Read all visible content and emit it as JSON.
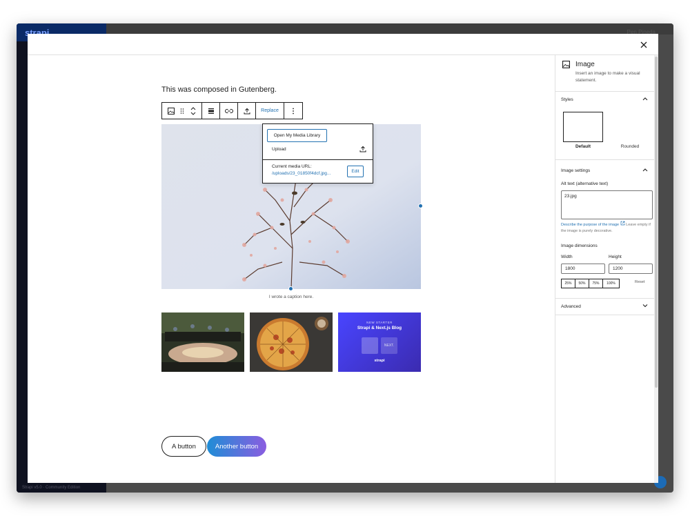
{
  "background": {
    "brand": "strapi",
    "user_menu": "Pen Pineda",
    "footer": "Strapi v5.0 · Community Edition"
  },
  "editor": {
    "paragraph": "This was composed in Gutenberg.",
    "toolbar": {
      "replace_label": "Replace",
      "icons": [
        "image-icon",
        "drag-icon",
        "move-updown-icon",
        "align-icon",
        "link-icon",
        "upload-icon",
        "more-vertical-icon"
      ]
    },
    "replace_popover": {
      "open_library": "Open My Media Library",
      "upload": "Upload",
      "current_url_label": "Current media URL:",
      "current_url": "/uploads/23_01850f4dcf.jpg...",
      "edit": "Edit"
    },
    "caption": "I wrote a caption here.",
    "gallery": {
      "blog_card": {
        "kicker": "NEW STARTER",
        "title": "Strapi & Next.js Blog",
        "next_logo": "NEXT.",
        "strapi_logo": "strapi"
      }
    },
    "buttons": {
      "outline": "A button",
      "gradient": "Another button"
    }
  },
  "sidebar": {
    "block_title": "Image",
    "block_desc": "Insert an image to make a visual statement.",
    "styles": {
      "title": "Styles",
      "default": "Default",
      "rounded": "Rounded"
    },
    "image_settings": {
      "title": "Image settings",
      "alt_label": "Alt text (alternative text)",
      "alt_value": "23.jpg",
      "help_link": "Describe the purpose of the image",
      "help_rest": "Leave empty if the image is purely decorative.",
      "dimensions_label": "Image dimensions",
      "width_label": "Width",
      "height_label": "Height",
      "width_value": "1800",
      "height_value": "1200",
      "percents": [
        "25%",
        "50%",
        "75%",
        "100%"
      ],
      "reset": "Reset"
    },
    "advanced": "Advanced"
  },
  "colors": {
    "accent": "#2271b1",
    "strapi_purple": "#4945ff"
  }
}
